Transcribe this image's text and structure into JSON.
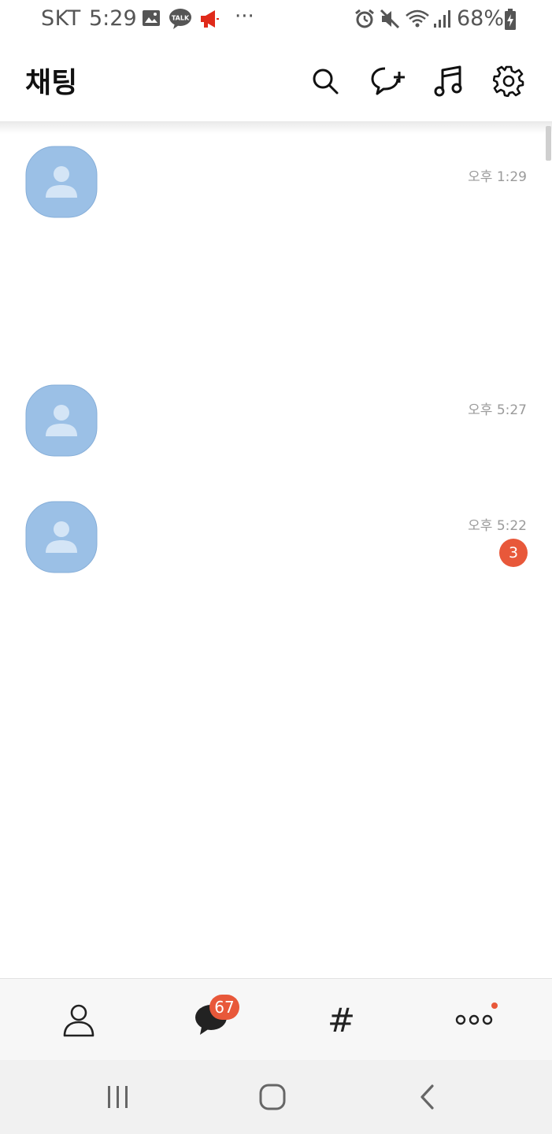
{
  "status_bar": {
    "carrier": "SKT",
    "time": "5:29",
    "battery_percent": "68%",
    "left_icons": [
      "gallery-icon",
      "kakaotalk-icon",
      "megaphone-icon",
      "more-dots-icon"
    ],
    "right_icons": [
      "alarm-icon",
      "mute-icon",
      "wifi-icon",
      "signal-icon",
      "battery-charging-icon"
    ],
    "talk_icon_text": "TALK",
    "more_dots": "···"
  },
  "header": {
    "title": "채팅",
    "actions": [
      "search-icon",
      "new-chat-icon",
      "music-icon",
      "settings-icon"
    ]
  },
  "chats": [
    {
      "time": "오후 1:29",
      "unread": ""
    },
    {
      "time": "오후 5:27",
      "unread": ""
    },
    {
      "time": "오후 5:22",
      "unread": "3"
    }
  ],
  "bottom_nav": {
    "items": [
      "friends-icon",
      "chats-icon",
      "openchat-icon",
      "more-icon"
    ],
    "chats_badge": "67",
    "hash_label": "#"
  },
  "system_nav": {
    "items": [
      "recent-apps-icon",
      "home-icon",
      "back-icon"
    ]
  },
  "colors": {
    "avatar_bg": "#9bc0e6",
    "avatar_figure": "#d4e5f6",
    "badge": "#e8583a",
    "alert_red": "#e02a1a"
  }
}
